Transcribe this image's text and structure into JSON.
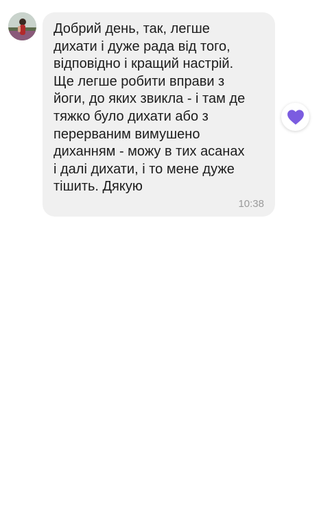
{
  "message": {
    "text": "Добрий день, так, легше\nдихати і дуже рада від того,\nвідповідно і кращий настрій.\nЩе легше робити вправи з\nйоги, до яких звикла - і там де\nтяжко було дихати або з\nперерваним вимушено\nдиханням - можу в тих асанах\nі далі дихати, і то мене дуже\nтішить. Дякую",
    "time": "10:38"
  },
  "reaction": {
    "icon": "heart-icon",
    "color": "#7b5ce0"
  },
  "colors": {
    "bubble": "#f0f0f0",
    "text": "#1c1c1c",
    "timestamp": "#9a9a9a"
  }
}
